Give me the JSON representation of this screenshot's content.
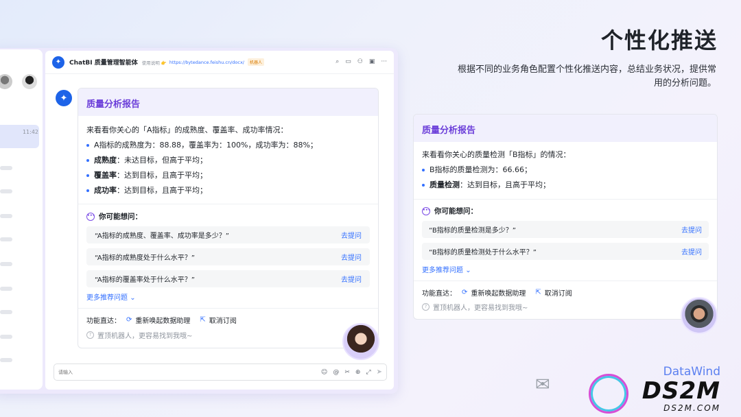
{
  "slide": {
    "title": "个性化推送",
    "subtitle": "根据不同的业务角色配置个性化推送内容，总结业务状况，提供常用的分析问题。"
  },
  "left_pane": {
    "time": "11:42"
  },
  "chat": {
    "title": "ChatBI 质量管理智能体",
    "desc": "使用说明 👉",
    "link": "https://bytedance.feishu.cn/docx/",
    "tag": "机器人"
  },
  "card_left": {
    "header": "质量分析报告",
    "intro": "来看看你关心的「A指标」的成熟度、覆盖率、成功率情况：",
    "bullets": [
      {
        "bold": "",
        "text": "A指标的成熟度为：88.88，覆盖率为：100%，成功率为：88%；"
      },
      {
        "bold": "成熟度",
        "text": "：未达目标，但高于平均；"
      },
      {
        "bold": "覆盖率",
        "text": "：达到目标，且高于平均；"
      },
      {
        "bold": "成功率",
        "text": "：达到目标，且高于平均；"
      }
    ],
    "suggest_title": "你可能想问：",
    "suggestions": [
      {
        "q": "“A指标的成熟度、覆盖率、成功率是多少？”",
        "ask": "去提问"
      },
      {
        "q": "“A指标的成熟度处于什么水平？”",
        "ask": "去提问"
      },
      {
        "q": "“A指标的覆盖率处于什么水平？”",
        "ask": "去提问"
      }
    ],
    "more": "更多推荐问题",
    "func_label": "功能直达：",
    "func_wake": "重新唤起数据助理",
    "func_unsub": "取消订阅",
    "tip": "置顶机器人，更容易找到我哦~"
  },
  "input": {
    "placeholder": "请输入"
  },
  "card_right": {
    "header": "质量分析报告",
    "intro": "来看看你关心的质量检测「B指标」的情况：",
    "bullets": [
      {
        "bold": "",
        "text": "B指标的质量检测为：66.66；"
      },
      {
        "bold": "质量检测",
        "text": "：达到目标，且高于平均；"
      }
    ],
    "suggest_title": "你可能想问：",
    "suggestions": [
      {
        "q": "“B指标的质量检测是多少？”",
        "ask": "去提问"
      },
      {
        "q": "“B指标的质量检测处于什么水平？”",
        "ask": "去提问"
      }
    ],
    "more": "更多推荐问题",
    "func_label": "功能直达：",
    "func_wake": "重新唤起数据助理",
    "func_unsub": "取消订阅",
    "tip": "置顶机器人，更容易找到我哦~"
  },
  "watermark": {
    "brand": "DataWind",
    "big": "DS2M",
    "small": "DS2M.COM"
  },
  "icons": {
    "header": [
      "search-icon",
      "video-icon",
      "add-member-icon",
      "calendar-icon",
      "more-icon"
    ],
    "input": [
      "emoji-icon",
      "at-icon",
      "scissors-icon",
      "plus-icon",
      "expand-icon",
      "send-icon"
    ]
  }
}
